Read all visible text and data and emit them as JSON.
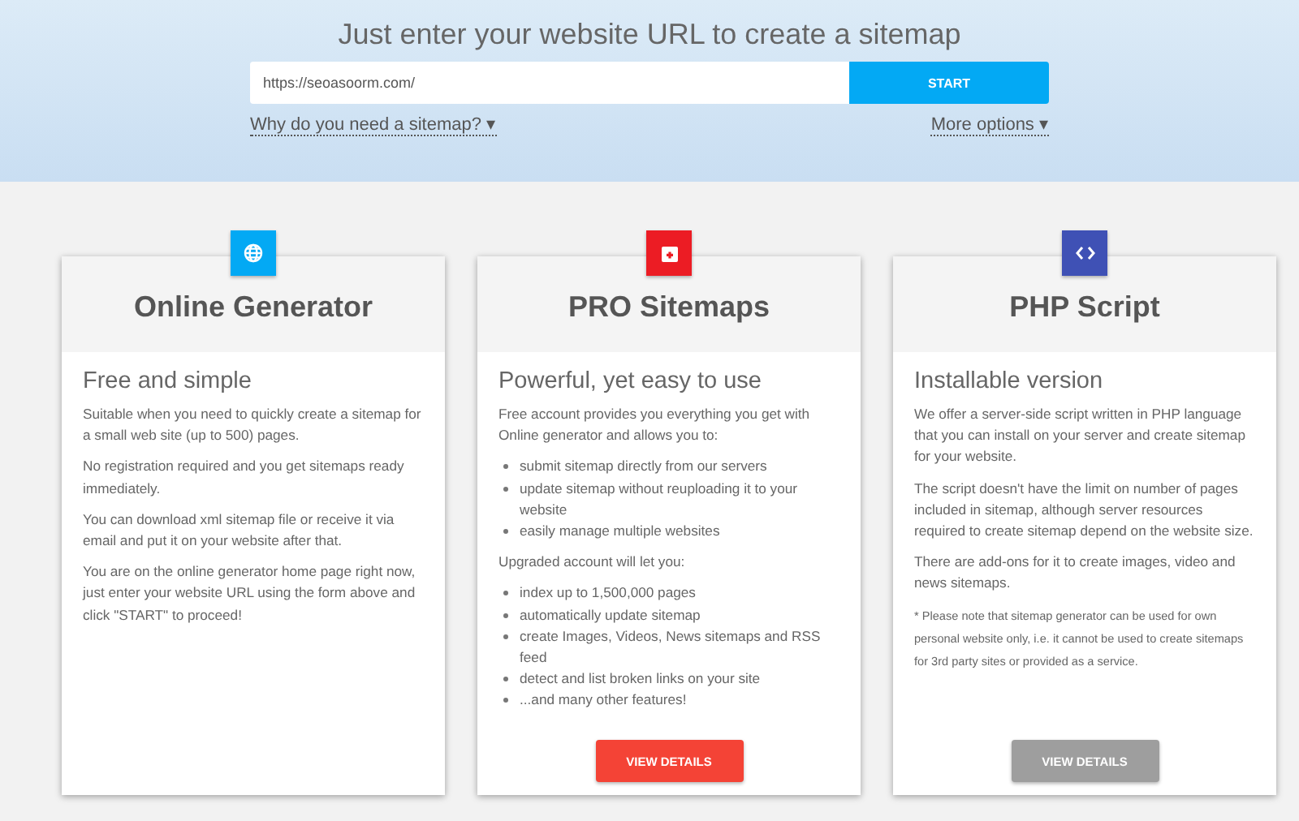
{
  "hero": {
    "title": "Just enter your website URL to create a sitemap",
    "url_field": {
      "value": "https://seoasoorm.com/"
    },
    "start_button": "START",
    "links": [
      {
        "label": "Why do you need a sitemap?",
        "caret": "▾"
      },
      {
        "label": "More options",
        "caret": "▾"
      }
    ]
  },
  "cards": [
    {
      "title": "Online Generator",
      "color": "#03a9f4",
      "subtitle": "Free and simple",
      "blocks": [
        {
          "kind": "paragraph",
          "text": "Suitable when you need to quickly create a sitemap for a small web site (up to 500) pages."
        },
        {
          "kind": "paragraph",
          "text": "No registration required and you get sitemaps ready immediately."
        },
        {
          "kind": "paragraph",
          "text": "You can download xml sitemap file or receive it via email and put it on your website after that."
        },
        {
          "kind": "paragraph",
          "text": "You are on the online generator home page right now, just enter your website URL using the form above and click \"START\" to proceed!"
        }
      ]
    },
    {
      "title": "PRO Sitemaps",
      "color": "#ec1c24",
      "subtitle": "Powerful, yet easy to use",
      "blocks": [
        {
          "kind": "paragraph",
          "text": "Free account provides you everything you get with Online generator and allows you to:"
        },
        {
          "kind": "list",
          "items": [
            "submit sitemap directly from our servers",
            "update sitemap without reuploading it to your website",
            "easily manage multiple websites"
          ]
        },
        {
          "kind": "paragraph",
          "text": "Upgraded account will let you:"
        },
        {
          "kind": "list",
          "items": [
            "index up to 1,500,000 pages",
            "automatically update sitemap",
            "create Images, Videos, News sitemaps and RSS feed",
            "detect and list broken links on your site",
            "...and many other features!"
          ]
        }
      ],
      "button": {
        "label": "VIEW DETAILS",
        "color": "#f44336"
      }
    },
    {
      "title": "PHP Script",
      "color": "#3f51b5",
      "subtitle": "Installable version",
      "blocks": [
        {
          "kind": "paragraph",
          "text": "We offer a server-side script written in PHP language that you can install on your server and create sitemap for your website."
        },
        {
          "kind": "paragraph",
          "text": "The script doesn't have the limit on number of pages included in sitemap, although server resources required to create sitemap depend on the website size."
        },
        {
          "kind": "paragraph",
          "text": "There are add-ons for it to create images, video and news sitemaps."
        },
        {
          "kind": "note",
          "text": "* Please note that sitemap generator can be used for own personal website only, i.e. it cannot be used to create sitemaps for 3rd party sites or provided as a service."
        }
      ],
      "button": {
        "label": "VIEW DETAILS",
        "color": "#9e9e9e"
      }
    }
  ]
}
